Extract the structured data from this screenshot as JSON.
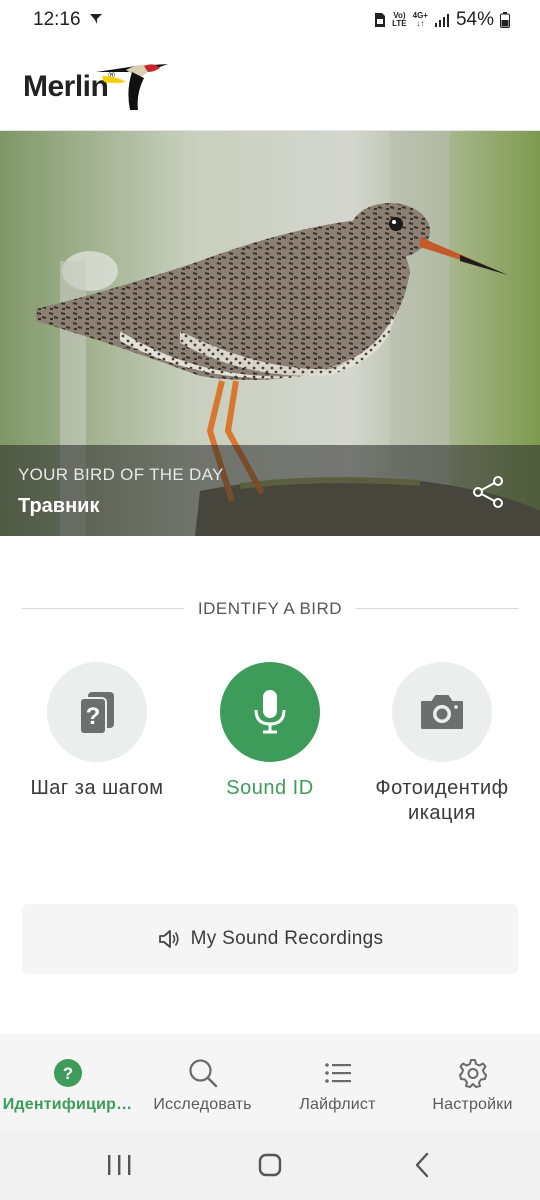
{
  "status_bar": {
    "time": "12:16",
    "network_top": "Vo)",
    "network_bottom": "LTE",
    "data_top": "4G+",
    "battery": "54%"
  },
  "header": {
    "logo_text": "Merlin",
    "logo_mark": "®"
  },
  "bird_of_day": {
    "kicker": "YOUR BIRD OF THE DAY",
    "name": "Травник"
  },
  "identify": {
    "section_label": "IDENTIFY A BIRD",
    "options": [
      {
        "label": "Шаг за шагом",
        "icon": "question-cards-icon",
        "active": false
      },
      {
        "label": "Sound ID",
        "icon": "microphone-icon",
        "active": true
      },
      {
        "label": "Фотоидентиф икация",
        "icon": "camera-icon",
        "active": false
      }
    ]
  },
  "recordings": {
    "label": "My Sound Recordings",
    "icon": "speaker-icon"
  },
  "bottom_nav": {
    "items": [
      {
        "label": "Идентифицир…",
        "icon": "question-circle-icon",
        "active": true
      },
      {
        "label": "Исследовать",
        "icon": "search-icon",
        "active": false
      },
      {
        "label": "Лайфлист",
        "icon": "list-icon",
        "active": false
      },
      {
        "label": "Настройки",
        "icon": "gear-icon",
        "active": false
      }
    ]
  },
  "colors": {
    "accent": "#3e9c5b",
    "inactive_circle": "#ebeeed",
    "nav_background": "#f4f5f4"
  }
}
